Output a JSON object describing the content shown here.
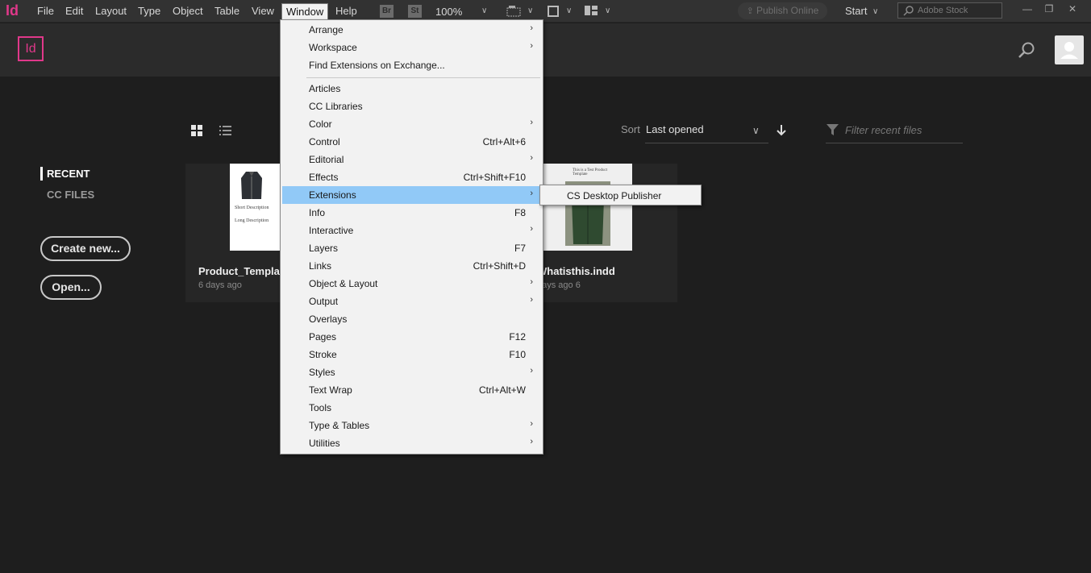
{
  "menubar": {
    "app_logo": "Id",
    "items": [
      "File",
      "Edit",
      "Layout",
      "Type",
      "Object",
      "Table",
      "View",
      "Window",
      "Help"
    ],
    "bridge_badge": "Br",
    "stock_badge": "St",
    "zoom": "100%",
    "publish_online": "Publish Online",
    "workspace": "Start",
    "stock_search_placeholder": "Adobe Stock"
  },
  "header": {
    "logo": "Id"
  },
  "home": {
    "nav": {
      "recent": "RECENT",
      "cc_files": "CC FILES"
    },
    "create_new": "Create new...",
    "open": "Open...",
    "sort_label": "Sort",
    "sort_value": "Last opened",
    "filter_placeholder": "Filter recent files",
    "files": [
      {
        "title": "Product_Template",
        "modified": "6 days ago",
        "thumb_lines": [
          "Short Description",
          "Long Description"
        ]
      },
      {
        "title": "Whatisthis.indd",
        "modified": "6 days ago",
        "thumb_lines": [
          "This is a Test Product Template"
        ]
      }
    ]
  },
  "window_menu": {
    "items": [
      {
        "label": "Arrange",
        "shortcut": "",
        "submenu": true
      },
      {
        "label": "Workspace",
        "shortcut": "",
        "submenu": true
      },
      {
        "label": "Find Extensions on Exchange...",
        "shortcut": "",
        "submenu": false
      },
      {
        "label": "Articles",
        "shortcut": "",
        "submenu": false
      },
      {
        "label": "CC Libraries",
        "shortcut": "",
        "submenu": false
      },
      {
        "label": "Color",
        "shortcut": "",
        "submenu": true
      },
      {
        "label": "Control",
        "shortcut": "Ctrl+Alt+6",
        "submenu": false
      },
      {
        "label": "Editorial",
        "shortcut": "",
        "submenu": true
      },
      {
        "label": "Effects",
        "shortcut": "Ctrl+Shift+F10",
        "submenu": false
      },
      {
        "label": "Extensions",
        "shortcut": "",
        "submenu": true,
        "highlighted": true
      },
      {
        "label": "Info",
        "shortcut": "F8",
        "submenu": false
      },
      {
        "label": "Interactive",
        "shortcut": "",
        "submenu": true
      },
      {
        "label": "Layers",
        "shortcut": "F7",
        "submenu": false
      },
      {
        "label": "Links",
        "shortcut": "Ctrl+Shift+D",
        "submenu": false
      },
      {
        "label": "Object & Layout",
        "shortcut": "",
        "submenu": true
      },
      {
        "label": "Output",
        "shortcut": "",
        "submenu": true
      },
      {
        "label": "Overlays",
        "shortcut": "",
        "submenu": false
      },
      {
        "label": "Pages",
        "shortcut": "F12",
        "submenu": false
      },
      {
        "label": "Stroke",
        "shortcut": "F10",
        "submenu": false
      },
      {
        "label": "Styles",
        "shortcut": "",
        "submenu": true
      },
      {
        "label": "Text Wrap",
        "shortcut": "Ctrl+Alt+W",
        "submenu": false
      },
      {
        "label": "Tools",
        "shortcut": "",
        "submenu": false
      },
      {
        "label": "Type & Tables",
        "shortcut": "",
        "submenu": true
      },
      {
        "label": "Utilities",
        "shortcut": "",
        "submenu": true
      }
    ]
  },
  "extensions_submenu": {
    "items": [
      "CS Desktop Publisher"
    ]
  },
  "colors": {
    "brand": "#e0388a",
    "highlight": "#91c9f7",
    "background": "#1e1e1e"
  }
}
